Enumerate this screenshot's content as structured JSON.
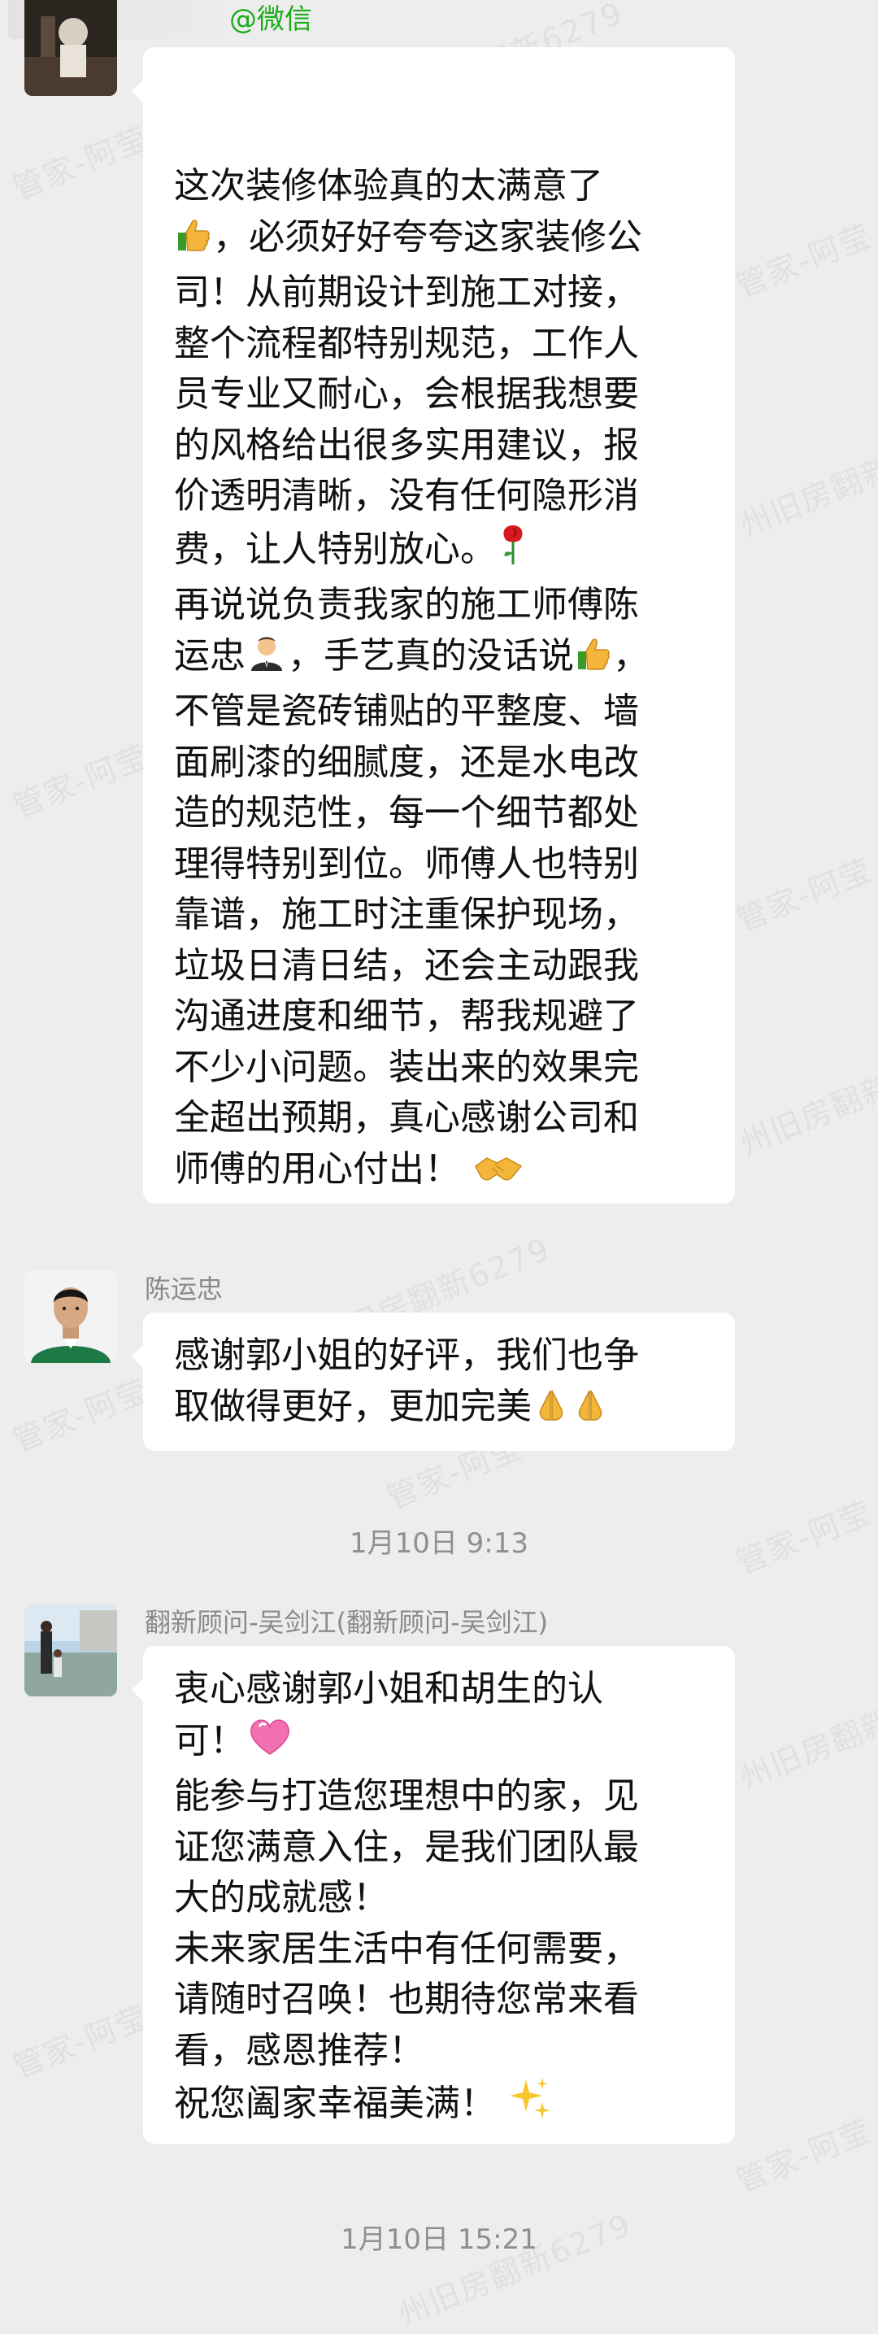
{
  "header": {
    "source_tag": "@微信"
  },
  "watermark": {
    "agent": "管家-阿莹",
    "shop": "州旧房翻新6279"
  },
  "messages": [
    {
      "sender": "",
      "avatar": "avatar-user-dark",
      "lines": [
        "这次装修体验真的太满意了",
        "，必须好好夸夸这家装修公",
        "司！从前期设计到施工对接，",
        "整个流程都特别规范，工作人",
        "员专业又耐心，会根据我想要",
        "的风格给出很多实用建议，报",
        "价透明清晰，没有任何隐形消",
        "费，让人特别放心。",
        "再说说负责我家的施工师傅陈",
        "运忠",
        "，手艺真的没话说",
        "不管是瓷砖铺贴的平整度、墙",
        "面刷漆的细腻度，还是水电改",
        "造的规范性，每一个细节都处",
        "理得特别到位。师傅人也特别",
        "靠谱，施工时注重保护现场，",
        "垃圾日清日结，还会主动跟我",
        "沟通进度和细节，帮我规避了",
        "不少小问题。装出来的效果完",
        "全超出预期，真心感谢公司和",
        "师傅的用心付出！"
      ],
      "emoji": {
        "thumbs_up": "thumbs-up-emoji",
        "rose": "rose-emoji",
        "worker": "man-in-suit-emoji",
        "handshake": "handshake-emoji",
        "comma": "，"
      }
    },
    {
      "sender": "陈运忠",
      "avatar": "avatar-chen",
      "lines": [
        "感谢郭小姐的好评，我们也争",
        "取做得更好，更加完美"
      ],
      "emoji": {
        "pray": "folded-hands-emoji"
      }
    },
    {
      "timestamp": "1月10日  9:13"
    },
    {
      "sender": "翻新顾问-吴剑江(翻新顾问-吴剑江)",
      "avatar": "avatar-wu",
      "lines": [
        "衷心感谢郭小姐和胡生的认",
        "可！",
        "能参与打造您理想中的家，见",
        "证您满意入住，是我们团队最",
        "大的成就感！",
        "未来家居生活中有任何需要，",
        "请随时召唤！也期待您常来看",
        "看，感恩推荐！",
        "祝您阖家幸福美满！"
      ],
      "emoji": {
        "heart": "pink-heart-emoji",
        "sparkles": "sparkles-emoji"
      }
    },
    {
      "timestamp": "1月10日  15:21"
    }
  ]
}
